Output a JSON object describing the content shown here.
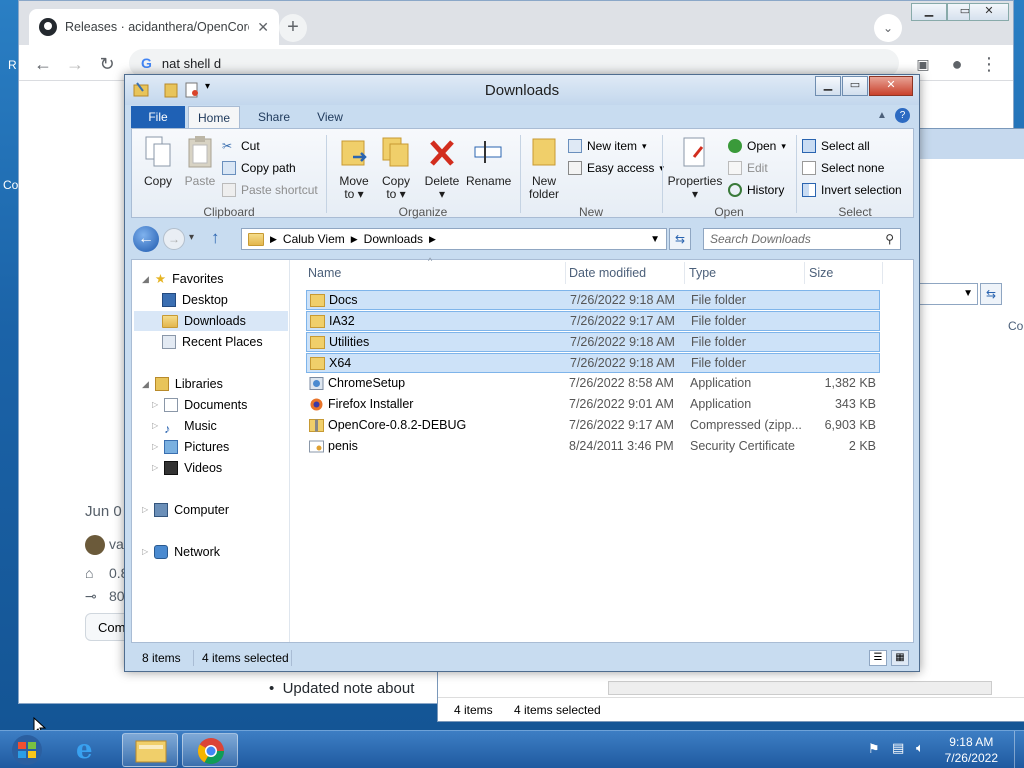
{
  "chrome": {
    "tab_title": "Releases · acidanthera/OpenCore",
    "new_tab": "+",
    "omnibox": "nat shell d",
    "page_date": "Jun 0",
    "page_user": "va",
    "page_tag": "0.8",
    "page_commit": "80",
    "page_button": "Com",
    "page_bullet": "Updated note about"
  },
  "desktop": {
    "side_labels": [
      "R",
      "Co"
    ]
  },
  "explorer": {
    "title": "Downloads",
    "tabs": {
      "file": "File",
      "home": "Home",
      "share": "Share",
      "view": "View"
    },
    "ribbon": {
      "copy": "Copy",
      "paste": "Paste",
      "cut": "Cut",
      "copy_path": "Copy path",
      "paste_shortcut": "Paste shortcut",
      "clipboard": "Clipboard",
      "move_to": "Move",
      "copy_to": "Copy",
      "to": "to",
      "delete": "Delete",
      "rename": "Rename",
      "organize": "Organize",
      "new_folder_1": "New",
      "new_folder_2": "folder",
      "new_item": "New item",
      "easy_access": "Easy access",
      "new": "New",
      "properties": "Properties",
      "open_btn": "Open",
      "edit": "Edit",
      "history": "History",
      "open": "Open",
      "select_all": "Select all",
      "select_none": "Select none",
      "invert_selection": "Invert selection",
      "select": "Select"
    },
    "address": {
      "crumbs": [
        "Calub Viem",
        "Downloads"
      ],
      "search_placeholder": "Search Downloads"
    },
    "nav": {
      "favorites": "Favorites",
      "desktop": "Desktop",
      "downloads": "Downloads",
      "recent": "Recent Places",
      "libraries": "Libraries",
      "documents": "Documents",
      "music": "Music",
      "pictures": "Pictures",
      "videos": "Videos",
      "computer": "Computer",
      "network": "Network"
    },
    "columns": {
      "name": "Name",
      "date": "Date modified",
      "type": "Type",
      "size": "Size"
    },
    "rows": [
      {
        "name": "Docs",
        "date": "7/26/2022 9:18 AM",
        "type": "File folder",
        "size": ""
      },
      {
        "name": "IA32",
        "date": "7/26/2022 9:17 AM",
        "type": "File folder",
        "size": ""
      },
      {
        "name": "Utilities",
        "date": "7/26/2022 9:18 AM",
        "type": "File folder",
        "size": ""
      },
      {
        "name": "X64",
        "date": "7/26/2022 9:18 AM",
        "type": "File folder",
        "size": ""
      },
      {
        "name": "ChromeSetup",
        "date": "7/26/2022 8:58 AM",
        "type": "Application",
        "size": "1,382 KB"
      },
      {
        "name": "Firefox Installer",
        "date": "7/26/2022 9:01 AM",
        "type": "Application",
        "size": "343 KB"
      },
      {
        "name": "OpenCore-0.8.2-DEBUG",
        "date": "7/26/2022 9:17 AM",
        "type": "Compressed (zipp...",
        "size": "6,903 KB"
      },
      {
        "name": "penis",
        "date": "8/24/2011 3:46 PM",
        "type": "Security Certificate",
        "size": "2 KB"
      }
    ],
    "status": {
      "items": "8 items",
      "selected": "4 items selected"
    }
  },
  "explorer_bg": {
    "col": "Co",
    "status_items": "4 items",
    "status_selected": "4 items selected"
  },
  "taskbar": {
    "time": "9:18 AM",
    "date": "7/26/2022"
  }
}
